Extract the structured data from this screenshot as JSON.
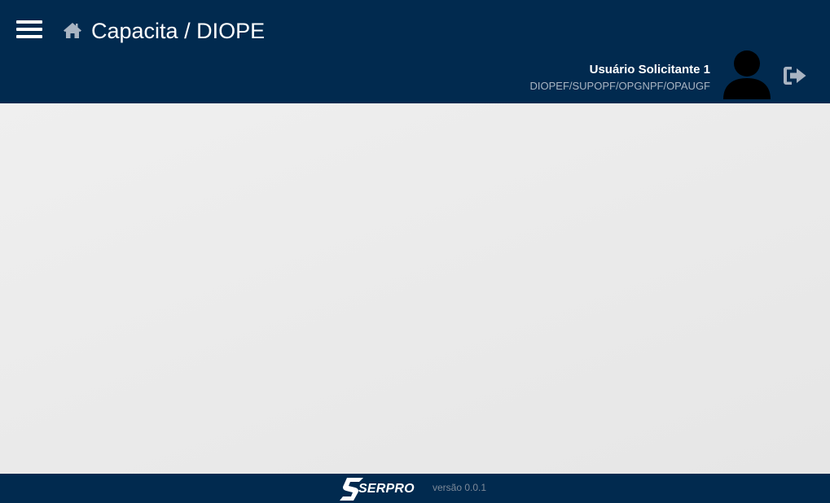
{
  "header": {
    "title": "Capacita / DIOPE",
    "user": {
      "name": "Usuário Solicitante 1",
      "unit": "DIOPEF/SUPOPF/OPGNPF/OPAUGF"
    },
    "icons": {
      "menu": "hamburger-icon",
      "home": "home-icon",
      "avatar": "user-icon",
      "logout": "sign-out-icon"
    }
  },
  "footer": {
    "brand": "SERPRO",
    "version": "versão 0.0.1"
  },
  "colors": {
    "header_bg": "#012a4f",
    "content_bg": "#e9e9e9",
    "accent_muted": "#a9b4c2"
  }
}
